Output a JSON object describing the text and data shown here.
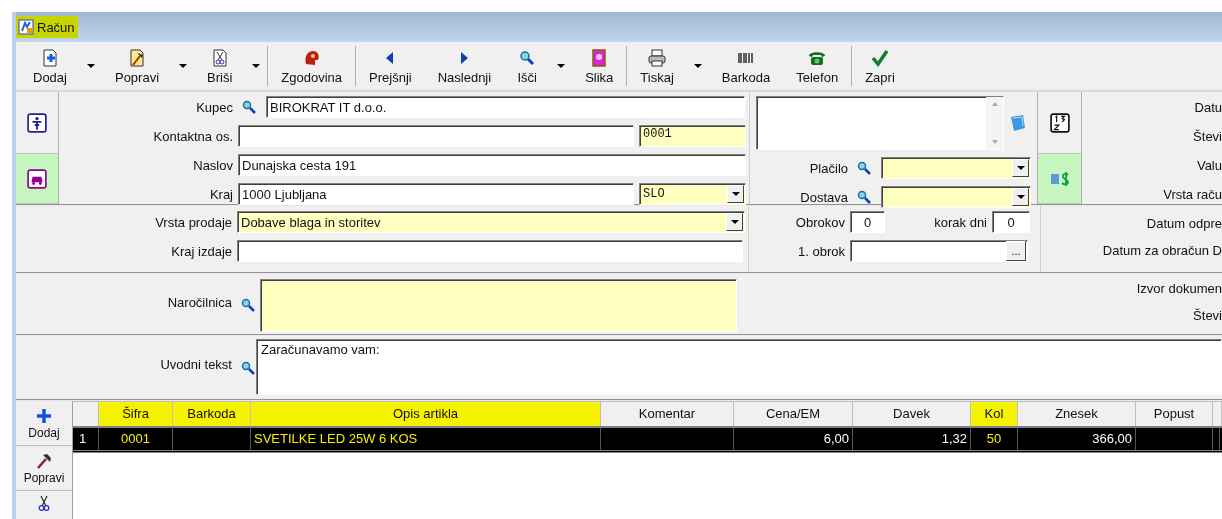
{
  "window": {
    "title": "Račun",
    "highlighted": true
  },
  "toolbar": [
    [
      {
        "kind": "button",
        "label": "Dodaj"
      },
      {
        "kind": "dropdown"
      },
      {
        "kind": "button",
        "label": "Popravi"
      },
      {
        "kind": "dropdown"
      },
      {
        "kind": "button",
        "label": "Briši"
      },
      {
        "kind": "dropdown"
      }
    ],
    [
      {
        "kind": "button",
        "label": "Zgodovina"
      }
    ],
    [
      {
        "kind": "button",
        "label": "Prejšnji"
      },
      {
        "kind": "button",
        "label": "Naslednji"
      },
      {
        "kind": "button",
        "label": "Išči"
      },
      {
        "kind": "dropdown"
      },
      {
        "kind": "button",
        "label": "Slika"
      }
    ],
    [
      {
        "kind": "button",
        "label": "Tiskaj"
      },
      {
        "kind": "dropdown"
      },
      {
        "kind": "button",
        "label": "Barkoda"
      },
      {
        "kind": "button",
        "label": "Telefon"
      }
    ],
    [
      {
        "kind": "button",
        "label": "Zapri"
      }
    ]
  ],
  "side_tabs": [
    {
      "selected": false
    },
    {
      "selected": true
    }
  ],
  "customer": {
    "kupec": {
      "label": "Kupec",
      "value": "BIROKRAT IT d.o.o."
    },
    "contact": {
      "label": "Kontaktna os.",
      "code": "0001"
    },
    "address": {
      "label": "Naslov",
      "value": "Dunajska cesta 191"
    },
    "city": {
      "label": "Kraj",
      "value": "1000 Ljubljana",
      "country": "SLO"
    }
  },
  "payment": {
    "label": "Plačilo"
  },
  "delivery": {
    "label": "Dostava"
  },
  "currency_tabs": [
    {
      "selected": false
    },
    {
      "selected": true
    }
  ],
  "document_labels": [
    "Datu",
    "Števi",
    "Valu",
    "Vrsta raču"
  ],
  "sale": {
    "type": {
      "label": "Vrsta prodaje",
      "value": "Dobave blaga in storitev"
    },
    "place": {
      "label": "Kraj izdaje"
    }
  },
  "installments": {
    "count": {
      "label": "Obrokov",
      "value": "0"
    },
    "step": {
      "label": "korak dni",
      "value": "0"
    },
    "first": {
      "label": "1. obrok",
      "button": "..."
    }
  },
  "date_labels": [
    "Datum odpre",
    "Datum za obračun D"
  ],
  "order": {
    "label": "Naročilnica"
  },
  "source_labels": [
    "Izvor dokumen",
    "Števi"
  ],
  "intro": {
    "label": "Uvodni tekst",
    "value": "Zaračunavamo vam:"
  },
  "grid_tools": [
    "Dodaj",
    "Popravi"
  ],
  "table": {
    "columns": [
      {
        "label": "Šifra",
        "highlighted": true
      },
      {
        "label": "Barkoda",
        "highlighted": true
      },
      {
        "label": "Opis artikla",
        "highlighted": true
      },
      {
        "label": "Komentar",
        "highlighted": false
      },
      {
        "label": "Cena/EM",
        "highlighted": false
      },
      {
        "label": "Davek",
        "highlighted": false
      },
      {
        "label": "Kol",
        "highlighted": true
      },
      {
        "label": "Znesek",
        "highlighted": false
      },
      {
        "label": "Popust",
        "highlighted": false
      }
    ],
    "rows": [
      {
        "number": "1",
        "selected": true,
        "cells": [
          "0001",
          null,
          "SVETILKE LED 25W 6 KOS",
          null,
          "6,00",
          "1,32",
          "50",
          "366,00",
          null
        ]
      }
    ]
  }
}
